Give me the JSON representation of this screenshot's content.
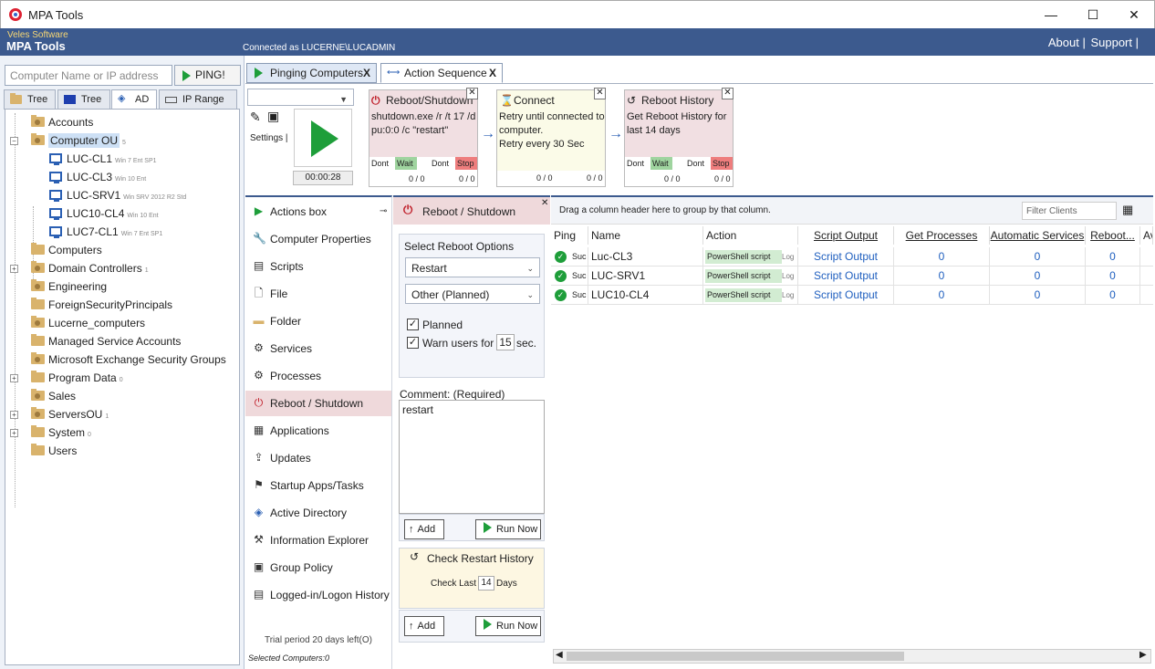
{
  "window": {
    "title": "MPA Tools",
    "min": "—",
    "max": "☐",
    "close": "✕"
  },
  "banner": {
    "vendor": "Veles Software",
    "product": "MPA Tools",
    "connected": "Connected as LUCERNE\\LUCADMIN",
    "about": "About |",
    "support": "Support |"
  },
  "search": {
    "placeholder": "Computer Name or IP address",
    "ping_label": "PING!"
  },
  "left_tabs": [
    "Tree 1",
    "Tree 2",
    "AD",
    "IP Range"
  ],
  "tree": [
    {
      "label": "Accounts",
      "sub": "",
      "type": "ou"
    },
    {
      "label": "Computer OU",
      "sub": "5",
      "type": "ou"
    },
    {
      "label": "LUC-CL1",
      "sub": "Win 7 Ent SP1",
      "type": "pc"
    },
    {
      "label": "LUC-CL3",
      "sub": "Win 10 Ent",
      "type": "pc"
    },
    {
      "label": "LUC-SRV1",
      "sub": "Win SRV 2012 R2 Std",
      "type": "pc"
    },
    {
      "label": "LUC10-CL4",
      "sub": "Win 10 Ent",
      "type": "pc"
    },
    {
      "label": "LUC7-CL1",
      "sub": "Win 7 Ent SP1",
      "type": "pc"
    },
    {
      "label": "Computers",
      "sub": "",
      "type": "folder"
    },
    {
      "label": "Domain Controllers",
      "sub": "1",
      "type": "ou"
    },
    {
      "label": "Engineering",
      "sub": "",
      "type": "ou"
    },
    {
      "label": "ForeignSecurityPrincipals",
      "sub": "",
      "type": "folder"
    },
    {
      "label": "Lucerne_computers",
      "sub": "",
      "type": "ou"
    },
    {
      "label": "Managed Service Accounts",
      "sub": "",
      "type": "folder"
    },
    {
      "label": "Microsoft Exchange Security Groups",
      "sub": "",
      "type": "ou"
    },
    {
      "label": "Program Data",
      "sub": "0",
      "type": "folder"
    },
    {
      "label": "Sales",
      "sub": "",
      "type": "ou"
    },
    {
      "label": "ServersOU",
      "sub": "1",
      "type": "ou"
    },
    {
      "label": "System",
      "sub": "0",
      "type": "folder"
    },
    {
      "label": "Users",
      "sub": "",
      "type": "folder"
    }
  ],
  "top_tabs": {
    "pinging": "Pinging Computers",
    "sequence": "Action Sequence",
    "close": "X"
  },
  "sequence": {
    "settings_label": "Settings |",
    "timer": "00:00:28",
    "cards": [
      {
        "title": "Reboot/Shutdown",
        "text": "shutdown.exe  /r /t 17 /d pu:0:0 /c \"restart\"",
        "dont1": "Dont",
        "b1": "Wait",
        "dont2": "Dont",
        "b2": "Stop",
        "c1": "0 / 0",
        "c2": "0 / 0"
      },
      {
        "title": "Connect",
        "text": "Retry until connected to computer.\nRetry every 30 Sec",
        "c1": "0 / 0",
        "c2": "0 / 0"
      },
      {
        "title": "Reboot History",
        "text": "Get Reboot History for last 14 days",
        "dont1": "Dont",
        "b1": "Wait",
        "dont2": "Dont",
        "b2": "Stop",
        "c1": "0 / 0",
        "c2": "0 / 0"
      }
    ]
  },
  "actions": [
    "Actions box",
    "Computer Properties",
    "Scripts",
    "File",
    "Folder",
    "Services",
    "Processes",
    "Reboot / Shutdown",
    "Applications",
    "Updates",
    "Startup Apps/Tasks",
    "Active Directory",
    "Information Explorer",
    "Group Policy",
    "Logged-in/Logon History"
  ],
  "actions_footer": {
    "trial": "Trial period 20 days left(O)",
    "selected": "Selected Computers:0"
  },
  "reboot": {
    "header": "Reboot / Shutdown",
    "options_title": "Select Reboot Options",
    "mode": "Restart",
    "reason": "Other (Planned)",
    "planned_label": "Planned",
    "warn_label": "Warn users for",
    "warn_value": "15",
    "warn_unit": "sec.",
    "comment_label": "Comment: (Required)",
    "comment": "restart",
    "add": "Add",
    "run": "Run Now",
    "history_title": "Check Restart History",
    "check_last": "Check Last",
    "days_value": "14",
    "days": "Days"
  },
  "grid": {
    "group_hint": "Drag a column header here to group by that column.",
    "filter_placeholder": "Filter Clients",
    "columns": [
      "Ping",
      "Name",
      "Action",
      "Script Output",
      "Get Processes",
      "Automatic Services",
      "Reboot...",
      "Av"
    ],
    "rows": [
      {
        "ping": "Suc",
        "name": "Luc-CL3",
        "action": "PowerShell script",
        "log": "Log",
        "output": "Script Output",
        "proc": "0",
        "svc": "0",
        "reboot": "0"
      },
      {
        "ping": "Suc",
        "name": "LUC-SRV1",
        "action": "PowerShell script",
        "log": "Log",
        "output": "Script Output",
        "proc": "0",
        "svc": "0",
        "reboot": "0"
      },
      {
        "ping": "Suc",
        "name": "LUC10-CL4",
        "action": "PowerShell script",
        "log": "Log",
        "output": "Script Output",
        "proc": "0",
        "svc": "0",
        "reboot": "0"
      }
    ]
  }
}
